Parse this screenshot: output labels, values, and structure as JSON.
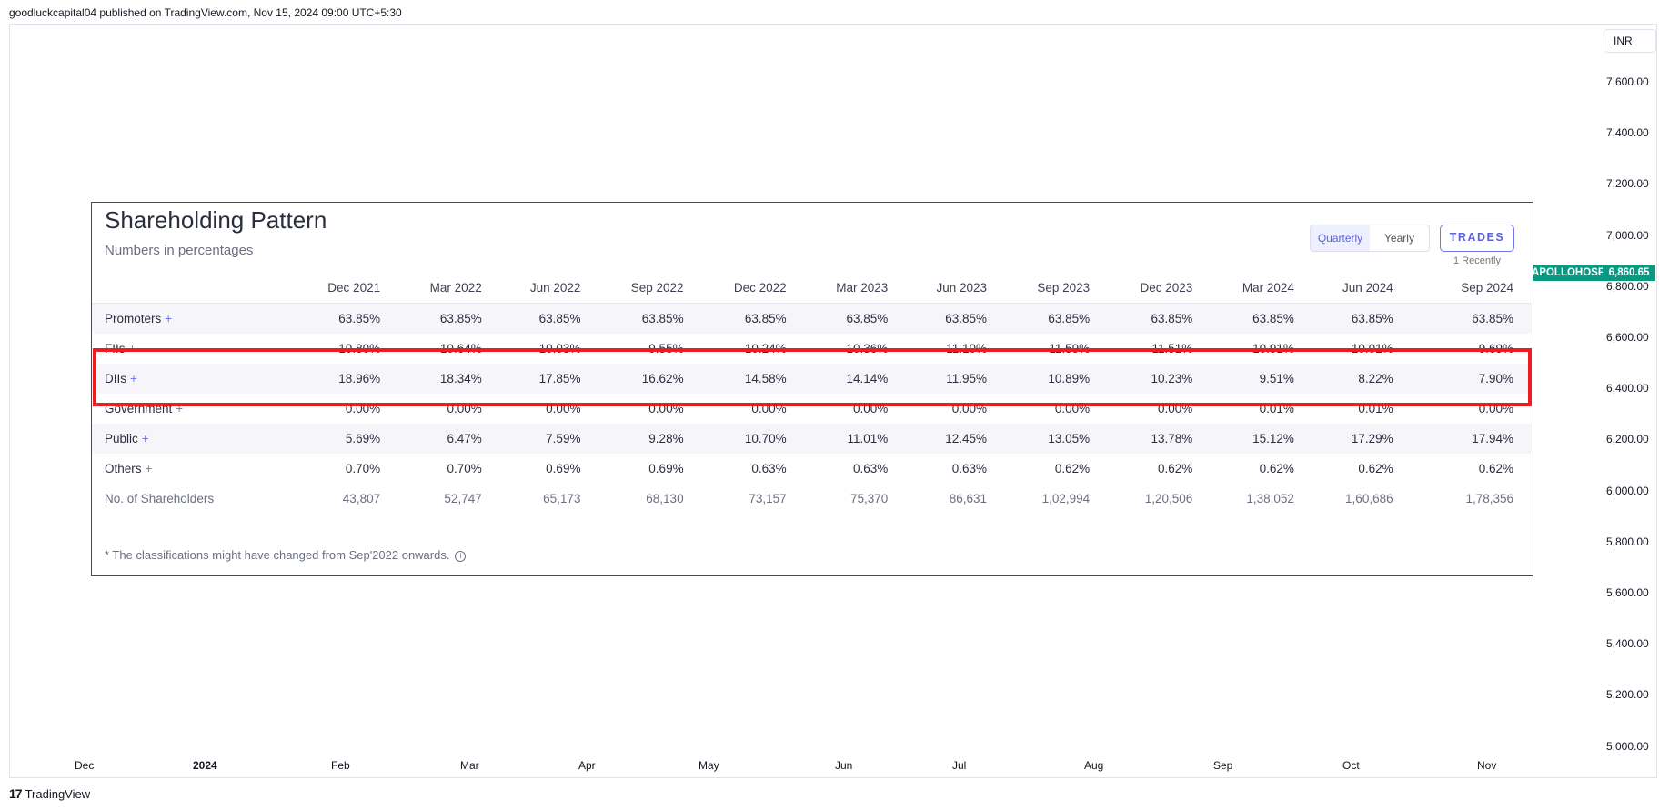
{
  "header": {
    "publish_line": "goodluckcapital04 published on TradingView.com, Nov 15, 2024 09:00 UTC+5:30"
  },
  "price_axis": {
    "currency": "INR",
    "labels": [
      "7,600.00",
      "7,400.00",
      "7,200.00",
      "7,000.00",
      "6,800.00",
      "6,600.00",
      "6,400.00",
      "6,200.00",
      "6,000.00",
      "5,800.00",
      "5,600.00",
      "5,400.00",
      "5,200.00",
      "5,000.00"
    ]
  },
  "time_axis": {
    "labels": [
      "Dec",
      "2024",
      "Feb",
      "Mar",
      "Apr",
      "May",
      "Jun",
      "Jul",
      "Aug",
      "Sep",
      "Oct",
      "Nov"
    ]
  },
  "price_marker": {
    "symbol": "APOLLOHOSP",
    "price": "6,860.65",
    "color": "#089981"
  },
  "footer": {
    "brand": "TradingView",
    "logo_mark": "17"
  },
  "panel": {
    "title": "Shareholding Pattern",
    "subtitle": "Numbers in percentages",
    "toggle": {
      "quarterly": "Quarterly",
      "yearly": "Yearly",
      "active": "Quarterly"
    },
    "trades_button": "TRADES",
    "trades_sub": "1 Recently",
    "columns": [
      "Dec 2021",
      "Mar 2022",
      "Jun 2022",
      "Sep 2022",
      "Dec 2022",
      "Mar 2023",
      "Jun 2023",
      "Sep 2023",
      "Dec 2023",
      "Mar 2024",
      "Jun 2024",
      "Sep 2024"
    ],
    "rows": [
      {
        "label": "Promoters",
        "plus": "+",
        "values": [
          "63.85%",
          "63.85%",
          "63.85%",
          "63.85%",
          "63.85%",
          "63.85%",
          "63.85%",
          "63.85%",
          "63.85%",
          "63.85%",
          "63.85%",
          "63.85%"
        ]
      },
      {
        "label": "FIIs",
        "plus": "+",
        "values": [
          "10.80%",
          "10.64%",
          "10.03%",
          "9.55%",
          "10.24%",
          "10.36%",
          "11.10%",
          "11.59%",
          "11.51%",
          "10.91%",
          "10.01%",
          "9.69%"
        ]
      },
      {
        "label": "DIIs",
        "plus": "+",
        "values": [
          "18.96%",
          "18.34%",
          "17.85%",
          "16.62%",
          "14.58%",
          "14.14%",
          "11.95%",
          "10.89%",
          "10.23%",
          "9.51%",
          "8.22%",
          "7.90%"
        ]
      },
      {
        "label": "Government",
        "plus": "+",
        "values": [
          "0.00%",
          "0.00%",
          "0.00%",
          "0.00%",
          "0.00%",
          "0.00%",
          "0.00%",
          "0.00%",
          "0.00%",
          "0.01%",
          "0.01%",
          "0.00%"
        ]
      },
      {
        "label": "Public",
        "plus": "+",
        "values": [
          "5.69%",
          "6.47%",
          "7.59%",
          "9.28%",
          "10.70%",
          "11.01%",
          "12.45%",
          "13.05%",
          "13.78%",
          "15.12%",
          "17.29%",
          "17.94%"
        ]
      },
      {
        "label": "Others",
        "plus": "+",
        "values": [
          "0.70%",
          "0.70%",
          "0.69%",
          "0.69%",
          "0.63%",
          "0.63%",
          "0.63%",
          "0.62%",
          "0.62%",
          "0.62%",
          "0.62%",
          "0.62%"
        ]
      },
      {
        "label": "No. of Shareholders",
        "plus": "",
        "values": [
          "43,807",
          "52,747",
          "65,173",
          "68,130",
          "73,157",
          "75,370",
          "86,631",
          "1,02,994",
          "1,20,506",
          "1,38,052",
          "1,60,686",
          "1,78,356"
        ]
      }
    ],
    "footnote": "* The classifications might have changed from Sep'2022 onwards.",
    "info_glyph": "i",
    "highlight_color": "#ee1c1c"
  }
}
